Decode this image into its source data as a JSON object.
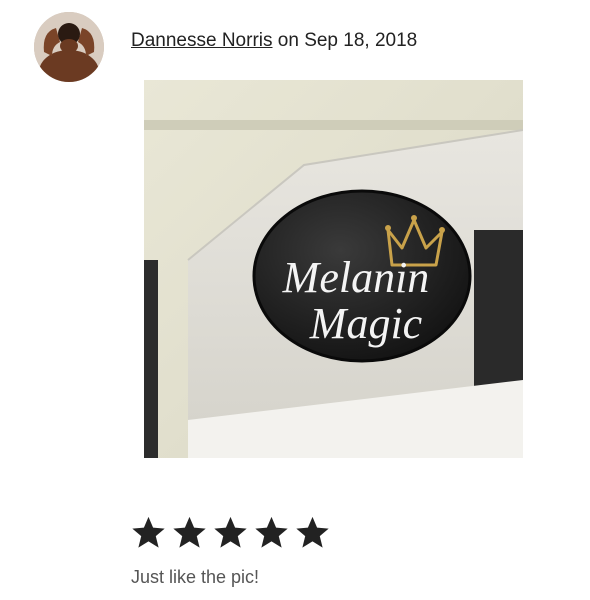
{
  "reviewer": {
    "name": "Dannesse Norris",
    "date_text": "on Sep 18, 2018",
    "avatar_icon": "reviewer-avatar"
  },
  "photo": {
    "badge_text_line1": "Melanin",
    "badge_text_line2": "Magic",
    "crown_icon": "crown-icon"
  },
  "rating": {
    "value": 5,
    "max": 5,
    "star_color": "#222222"
  },
  "review": {
    "text": "Just like the pic!"
  }
}
